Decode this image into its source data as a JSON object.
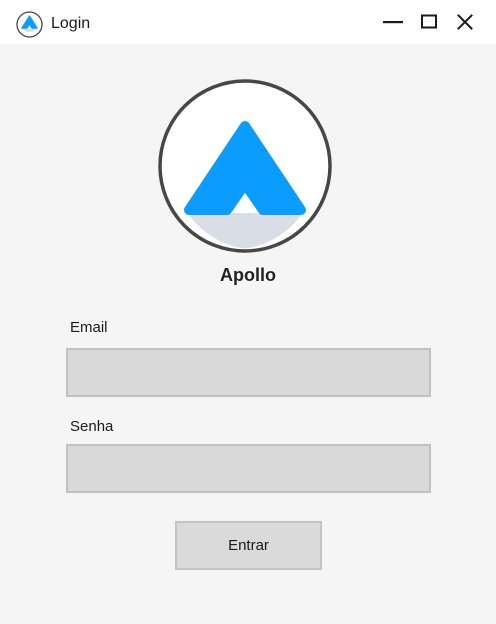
{
  "window": {
    "title": "Login",
    "app_icon": "apollo-logo-icon",
    "controls": {
      "minimize_icon": "minimize-icon",
      "maximize_icon": "maximize-icon",
      "close_icon": "close-icon"
    }
  },
  "logo": {
    "icon": "apollo-logo-icon",
    "app_name": "Apollo"
  },
  "form": {
    "email_label": "Email",
    "email_value": "",
    "password_label": "Senha",
    "password_value": "",
    "submit_label": "Entrar"
  },
  "colors": {
    "brand_blue": "#0a9cff",
    "content_background": "#f5f5f5",
    "input_background": "#d9d9d9",
    "input_border": "#c2c2c2",
    "logo_ring": "#474747"
  }
}
